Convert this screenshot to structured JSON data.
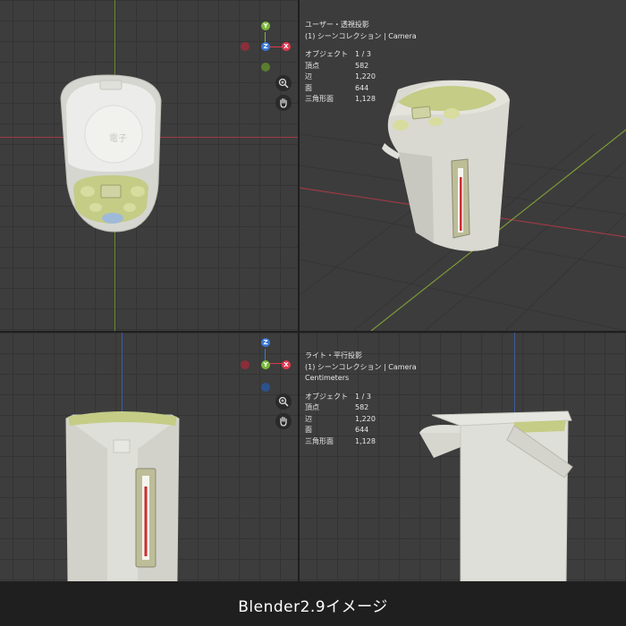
{
  "views": {
    "perspective": {
      "title": "ユーザー・透視投影",
      "collection": "(1) シーンコレクション | Camera",
      "stats": [
        {
          "label": "オブジェクト",
          "value": "1 / 3"
        },
        {
          "label": "頂点",
          "value": "582"
        },
        {
          "label": "辺",
          "value": "1,220"
        },
        {
          "label": "面",
          "value": "644"
        },
        {
          "label": "三角形面",
          "value": "1,128"
        }
      ]
    },
    "right": {
      "title": "ライト・平行投影",
      "collection": "(1) シーンコレクション | Camera",
      "units": "Centimeters",
      "stats": [
        {
          "label": "オブジェクト",
          "value": "1 / 3"
        },
        {
          "label": "頂点",
          "value": "582"
        },
        {
          "label": "辺",
          "value": "1,220"
        },
        {
          "label": "面",
          "value": "644"
        },
        {
          "label": "三角形面",
          "value": "1,128"
        }
      ]
    }
  },
  "gizmo": {
    "x": "X",
    "y": "Y",
    "z": "Z"
  },
  "icons": [
    "zoom-icon",
    "hand-pan-icon"
  ],
  "colors": {
    "x_axis": "#e0384f",
    "y_axis": "#7ab83a",
    "z_axis": "#3a78d6",
    "viewport_bg": "#3d3d3d",
    "appliance_body": "#e6e6e0",
    "panel_green": "#c4cc86"
  },
  "caption": "Blender2.9イメージ"
}
